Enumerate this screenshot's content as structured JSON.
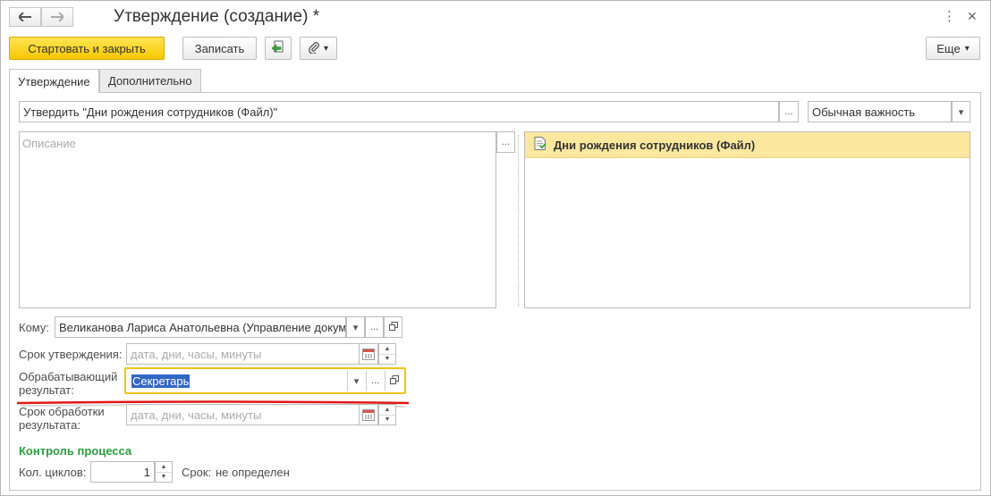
{
  "window": {
    "title": "Утверждение (создание) *",
    "back_icon": "arrow-left-icon",
    "forward_icon": "arrow-right-icon"
  },
  "toolbar": {
    "start_close_label": "Стартовать и закрыть",
    "save_label": "Записать",
    "more_label": "Еще",
    "accent": "#f6c800"
  },
  "tabs": [
    {
      "label": "Утверждение",
      "active": true
    },
    {
      "label": "Дополнительно",
      "active": false
    }
  ],
  "form": {
    "subject_value": "Утвердить \"Дни рождения сотрудников (Файл)\"",
    "importance_value": "Обычная важность",
    "description_placeholder": "Описание",
    "attachment_title": "Дни рождения сотрудников (Файл)",
    "to_label": "Кому:",
    "to_value": "Великанова Лариса Анатольевна (Управление докум",
    "deadline_label": "Срок утверждения:",
    "deadline_placeholder": "дата, дни, часы, минуты",
    "processor_label": "Обрабатывающий результат:",
    "processor_value": "Секретарь",
    "process_deadline_label": "Срок обработки результата:",
    "process_deadline_placeholder": "дата, дни, часы, минуты",
    "control_heading": "Контроль процесса",
    "cycles_label": "Кол. циклов:",
    "cycles_value": "1",
    "term_label": "Срок:",
    "term_value": "не определен"
  },
  "common": {
    "ellipsis": "...",
    "dropdown_arrow": "▾"
  }
}
